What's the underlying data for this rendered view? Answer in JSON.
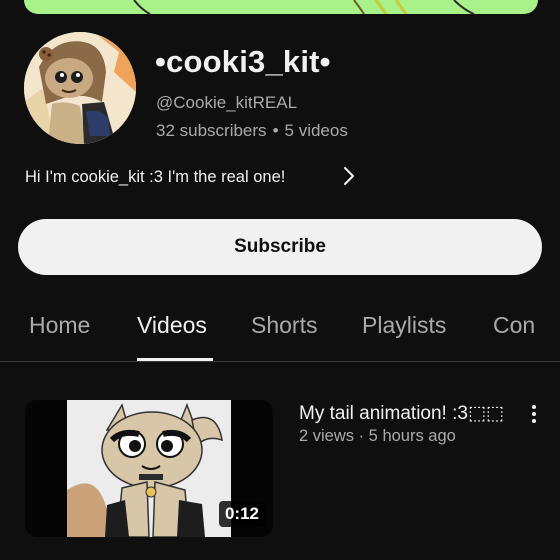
{
  "channel": {
    "name": "•cooki3_kit•",
    "handle": "@Cookie_kitREAL",
    "subscribers": "32 subscribers",
    "separator": "•",
    "videos_count": "5 videos",
    "bio": "Hi I'm cookie_kit :3 I'm the real one!"
  },
  "subscribe_label": "Subscribe",
  "tabs": [
    {
      "label": "Home"
    },
    {
      "label": "Videos",
      "active": true
    },
    {
      "label": "Shorts"
    },
    {
      "label": "Playlists"
    },
    {
      "label": "Con"
    }
  ],
  "videos": [
    {
      "title": "My tail animation! :3⬚⬚",
      "meta": "2 views · 5 hours ago",
      "duration": "0:12"
    }
  ],
  "icons": {
    "bio_more": "chevron-right-icon",
    "video_menu": "more-vertical-icon"
  },
  "colors": {
    "background": "#0f0f0f",
    "banner": "#a9f28a",
    "subscribe_bg": "#f1f1f1",
    "secondary_text": "#aaaaaa"
  }
}
